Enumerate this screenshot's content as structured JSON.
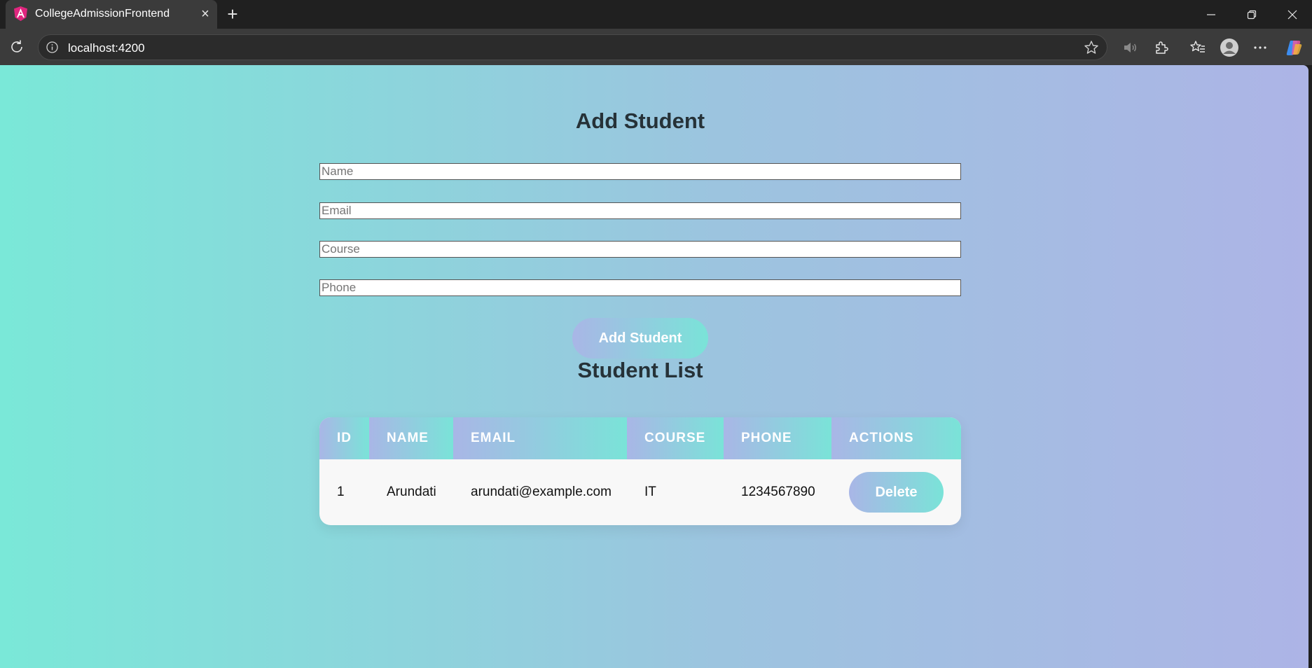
{
  "browser": {
    "tab_title": "CollegeAdmissionFrontend",
    "url": "localhost:4200"
  },
  "form": {
    "title": "Add Student",
    "name_placeholder": "Name",
    "email_placeholder": "Email",
    "course_placeholder": "Course",
    "phone_placeholder": "Phone",
    "submit_label": "Add Student"
  },
  "list": {
    "title": "Student List",
    "columns": [
      "ID",
      "NAME",
      "EMAIL",
      "COURSE",
      "PHONE",
      "ACTIONS"
    ],
    "rows": [
      {
        "id": "1",
        "name": "Arundati",
        "email": "arundati@example.com",
        "course": "IT",
        "phone": "1234567890",
        "action_label": "Delete"
      }
    ]
  },
  "colors": {
    "gradient_start": "#7ae8d8",
    "gradient_end": "#adb4e6",
    "heading": "#263238"
  }
}
